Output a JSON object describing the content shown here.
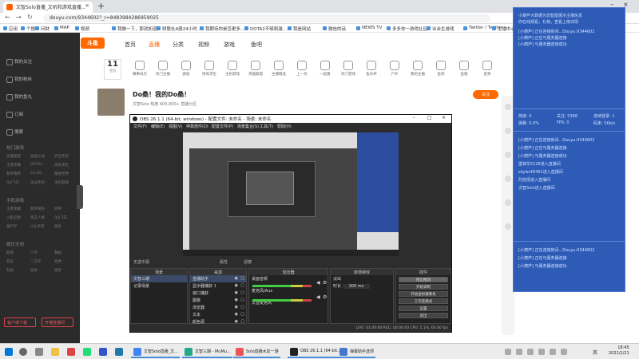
{
  "browser": {
    "tabs": [
      {
        "label": "文智Solo直播_文机和游戏直播..."
      }
    ],
    "url": "douyu.com/9344602?_r=8483984286959025",
    "bookmarks": [
      "应用",
      "个搜",
      "问财",
      "MAP",
      "视频",
      "我做一下，那就知道",
      "财联社A股24小时...",
      "我期待你是否更多...",
      "DOTA2不够刺激...",
      "我是网站",
      "微信的话",
      "NEWS TV",
      "多多你一游戏社区",
      "业余生游戏",
      "Twitter / Twitter",
      "主播中心"
    ]
  },
  "sidebar": {
    "items": [
      "我的关注",
      "我的粉丝",
      "我的鱼丸",
      "订阅",
      "搜索"
    ],
    "sections": [
      {
        "title": "热门游戏",
        "grid": [
          "英雄联盟",
          "穿越火线",
          "炉石传说",
          "王者荣耀",
          "DOTA2",
          "绝地求生",
          "和平精英",
          "CS:GO",
          "魔兽世界",
          "QQ飞车",
          "永劫无间",
          "主机游戏"
        ]
      },
      {
        "title": "手机游戏",
        "grid": [
          "王者荣耀",
          "和平精英",
          "原神",
          "火影忍者",
          "第五人格",
          "QQ飞车",
          "金铲铲",
          "LOL手游",
          "更多"
        ]
      },
      {
        "title": "娱乐天地",
        "grid": [
          "颜值",
          "户外",
          "舞蹈",
          "音乐",
          "二次元",
          "星秀",
          "科技",
          "美食",
          "更多"
        ]
      }
    ],
    "btn_left": "客户端下载",
    "btn_right": "开播直播间"
  },
  "header": {
    "logo": "斗鱼",
    "nav": [
      "首页",
      "直播",
      "分类",
      "视频",
      "游戏",
      "鱼吧"
    ],
    "active_nav": "直播"
  },
  "categories": {
    "calendar_day": "11",
    "calendar_sub": "签到",
    "items": [
      "赛事日历",
      "热门主播",
      "颜值",
      "绝地求生",
      "主机游戏",
      "英雄联盟",
      "主播精选",
      "上一页",
      "一起看",
      "热门游戏",
      "鱼乐杯",
      "户外",
      "我的主播",
      "鱼吧",
      "鱼塘",
      "星秀"
    ]
  },
  "stream": {
    "title": "Do桑！我的Do桑！",
    "meta": "文智Solo   热度   400,000+   直播分区",
    "follow": "关注"
  },
  "obs": {
    "title": "OBS 26.1.1 (64-bit, windows) - 配置文件: 未命名 - 场景: 未命名",
    "menu": [
      "文件(F)",
      "编辑(E)",
      "视图(V)",
      "停靠部件(D)",
      "配置文件(P)",
      "场景集合(S)",
      "工具(T)",
      "帮助(H)"
    ],
    "scene_label": "无选中源",
    "scene_tabs": [
      "属性",
      "滤镜"
    ],
    "panels": {
      "scenes": {
        "title": "场景",
        "rows": [
          "文智三期",
          "记录场景"
        ]
      },
      "sources": {
        "title": "来源",
        "rows": [
          "直播助手",
          "显示器捕获 1",
          "窗口捕获",
          "图像",
          "浏览器",
          "文本",
          "颜色源"
        ]
      },
      "mixer": {
        "title": "混音器",
        "channels": [
          "桌面音频",
          "麦克风/Aux",
          "文智麦克风"
        ]
      },
      "transitions": {
        "title": "转场特效",
        "type": "淡出",
        "duration_label": "时长",
        "duration": "300 ms"
      },
      "controls": {
        "title": "控件",
        "buttons": [
          "停止推流",
          "开始录制",
          "开始虚拟摄像机",
          "工作室模式",
          "设置",
          "退出"
        ]
      }
    },
    "status": "LIVE: 01:00:00   REC: 00:00:00   CPU: 5.1%, 60.00 fps"
  },
  "chat": {
    "top_lines": [
      "[小葫芦] 正在连接房间...Douyu:9344602",
      "[小葫芦] 正在与服务器连接",
      "[小葫芦] 与服务器连接成功"
    ],
    "header_note": "小葫芦大数据为您智能展示主播信息",
    "header_note2": "你在线观看，礼物，查看上榜详情",
    "stats": [
      {
        "label": "热度",
        "value": "0"
      },
      {
        "label": "关注",
        "value": "5366"
      },
      {
        "label": "连续登录",
        "value": "1"
      },
      {
        "label": "弹幕",
        "value": "0.0%"
      },
      {
        "label": "FPS",
        "value": "0"
      },
      {
        "label": "码率",
        "value": "5Kb/s"
      }
    ],
    "mid_lines": [
      "[小葫芦] 正在连接房间...Douyu:9344602",
      "[小葫芦] 正在与服务器连接",
      "[小葫芦] 与服务器连接成功",
      "墨锦华5128进入直播间",
      "skylar48361进入直播间",
      "烈焰情进入直播间",
      "文智Solo进入直播间"
    ],
    "bottom_lines": [
      "[小葫芦] 正在连接房间...Douyu:9344602",
      "[小葫芦] 正在与服务器连接",
      "[小葫芦] 与服务器连接成功"
    ]
  },
  "taskbar": {
    "apps": [
      "文智Solo直播_文...",
      "文智三期 - MuMu...",
      "Solo直播水友一游",
      "OBS 26.1.1 (64-bit...",
      "弹幕助手选项"
    ],
    "time": "18:45",
    "date": "2021/1/21",
    "lang": "英"
  },
  "colors": {
    "brand": "#ff6a00",
    "chat_bg": "#2d5bb5",
    "obs_bg": "#2d2d2d"
  }
}
